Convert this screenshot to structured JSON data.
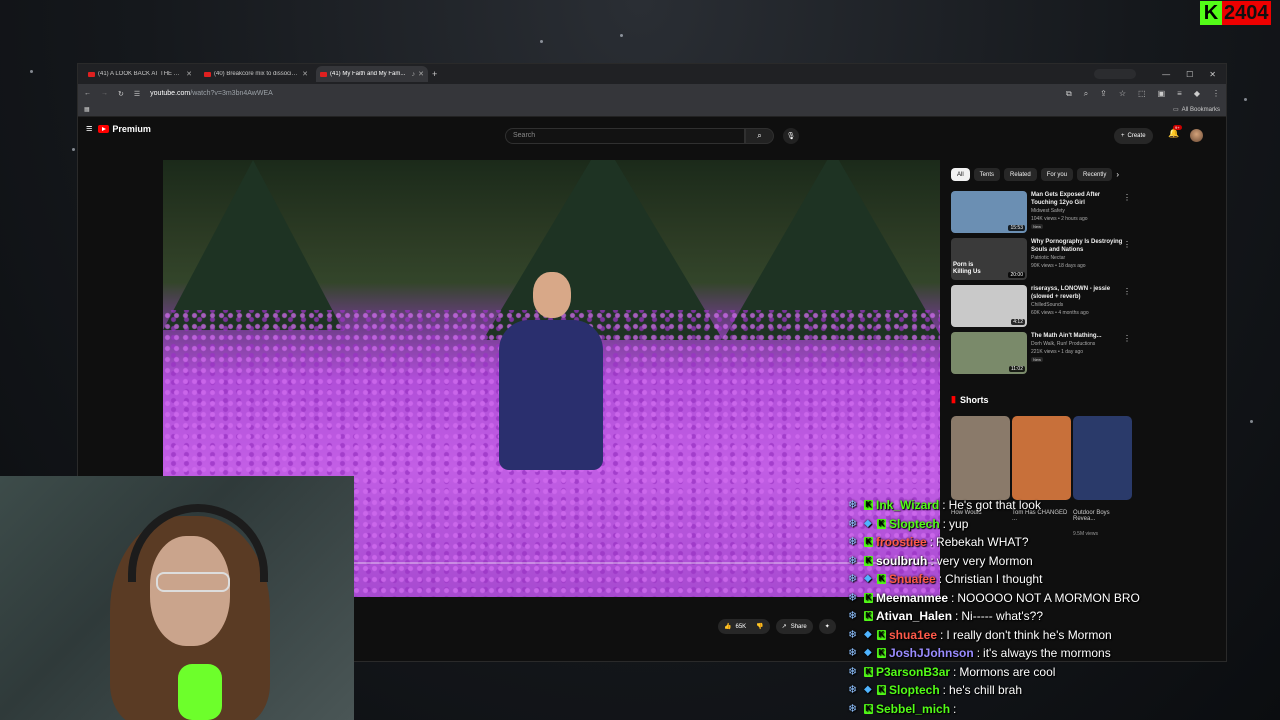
{
  "browser": {
    "tabs": [
      {
        "title": "(41) A LOOK BACK AT THE AM...",
        "active": false
      },
      {
        "title": "(40) Breakcore mix to dissocia...",
        "active": false
      },
      {
        "title": "(41) My Faith and My Fam...",
        "active": true
      }
    ],
    "url_host": "youtube.com",
    "url_rest": "/watch?v=3m3bn4AwWEA",
    "bookmarks_label": "All Bookmarks"
  },
  "youtube": {
    "logo_text": "Premium",
    "search_placeholder": "Search",
    "create_label": "Create",
    "notif_count": "9+",
    "chips": [
      "All",
      "Tents",
      "Related",
      "For you",
      "Recently"
    ],
    "recommendations": [
      {
        "title": "Man Gets Exposed After Touching 12yo Girl",
        "channel": "Midwest Safety",
        "stats": "104K views • 2 hours ago",
        "badge": "New",
        "duration": "15:53",
        "thumb_color": "#6b8fb3"
      },
      {
        "title": "Why Pornography Is Destroying Souls and Nations",
        "channel": "Patriotic Nectar",
        "stats": "90K views • 18 days ago",
        "badge": "",
        "duration": "20:00",
        "thumb_color": "#3a3a3a",
        "thumb_text": "Porn is Killing Us"
      },
      {
        "title": "riserayss, LONOWN - jessie (slowed + reverb)",
        "channel": "ChilledSounds",
        "stats": "60K views • 4 months ago",
        "badge": "",
        "duration": "4:12",
        "thumb_color": "#c9c9c9"
      },
      {
        "title": "The Math Ain't Mathing...",
        "channel": "Dorh Walk, Run! Productions",
        "stats": "221K views • 1 day ago",
        "badge": "New",
        "duration": "11:02",
        "thumb_color": "#7a8a6a"
      }
    ],
    "shorts_title": "Shorts",
    "shorts": [
      {
        "title": "How Would",
        "thumb_color": "#8a7a6a"
      },
      {
        "title": "Tom Has CHANGED ...",
        "thumb_color": "#c8703a"
      },
      {
        "title": "Outdoor Boys Revea...",
        "views": "9.5M views",
        "thumb_color": "#2a3a6a"
      }
    ],
    "actions": {
      "likes": "65K",
      "share": "Share"
    }
  },
  "chat": [
    {
      "user": "Ink_Wizard",
      "color": "#53fc18",
      "text": "He's got that look",
      "gem": false
    },
    {
      "user": "Sloptech",
      "color": "#53fc18",
      "text": "yup",
      "gem": true
    },
    {
      "user": "froostiee",
      "color": "#ff5a4a",
      "text": "Rebekah WHAT?",
      "gem": false
    },
    {
      "user": "soulbruh",
      "color": "#ffffff",
      "text": "very very Mormon",
      "gem": false
    },
    {
      "user": "Snuafee",
      "color": "#ff5a4a",
      "text": "Christian I thought",
      "gem": true
    },
    {
      "user": "Meemanmee",
      "color": "#ffffff",
      "text": "NOOOOO NOT A MORMON BRO",
      "gem": false
    },
    {
      "user": "Ativan_Halen",
      "color": "#ffffff",
      "text": "Ni----- what's??",
      "gem": false
    },
    {
      "user": "shua1ee",
      "color": "#ff5a4a",
      "text": "I really don't think he's Mormon",
      "gem": true
    },
    {
      "user": "JoshJJohnson",
      "color": "#9a8cff",
      "text": "it's always the mormons",
      "gem": true
    },
    {
      "user": "P3arsonB3ar",
      "color": "#53fc18",
      "text": "Mormons are cool",
      "gem": false
    },
    {
      "user": "Sloptech",
      "color": "#53fc18",
      "text": "he's chill brah",
      "gem": true
    },
    {
      "user": "Sebbel_mich",
      "color": "#53fc18",
      "text": "",
      "gem": false
    }
  ],
  "overlay": {
    "kick_letter": "K",
    "count": "2404"
  },
  "colors": {
    "kick_green": "#53fc18",
    "yt_red": "#ff0000",
    "yt_bg": "#0f0f0f"
  }
}
